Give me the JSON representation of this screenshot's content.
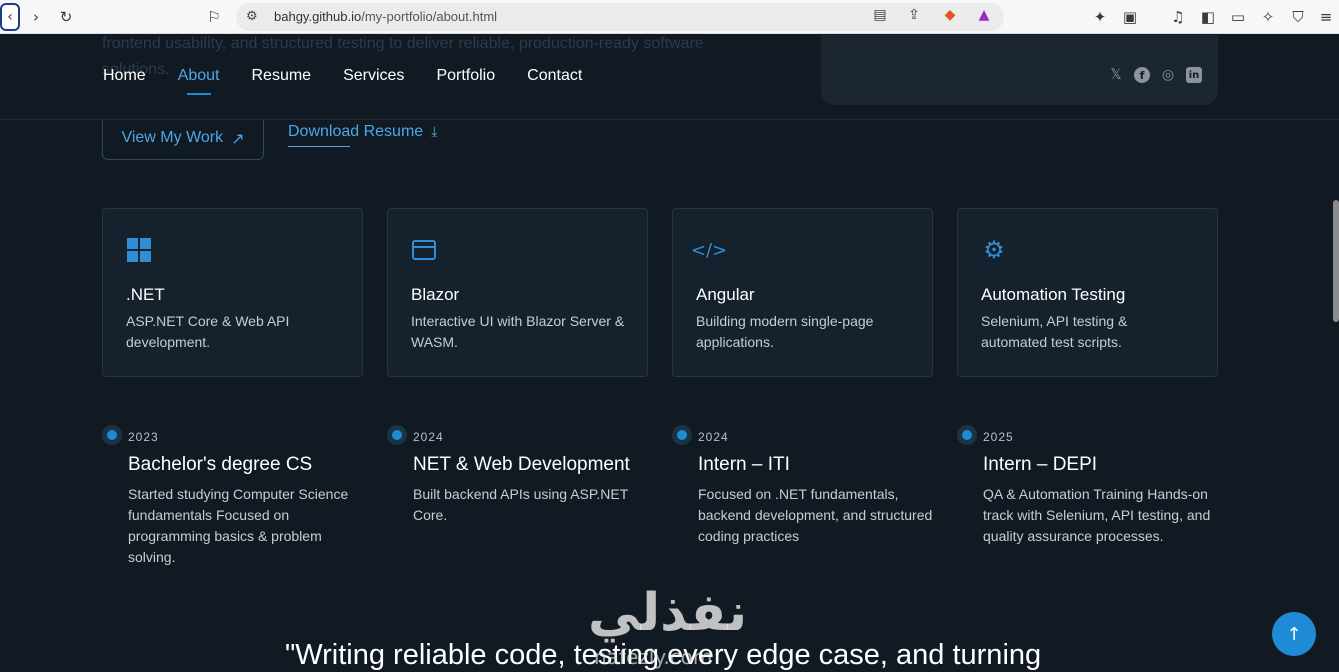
{
  "browser": {
    "url_host": "bahgy.github.io",
    "url_path": "/my-portfolio/about.html"
  },
  "hero": {
    "faded_text": "frontend usability, and structured testing to deliver reliable, production-ready software solutions.",
    "view_work": "View My Work",
    "download_resume": "Download Resume"
  },
  "nav": {
    "items": [
      {
        "label": "Home"
      },
      {
        "label": "About"
      },
      {
        "label": "Resume"
      },
      {
        "label": "Services"
      },
      {
        "label": "Portfolio"
      },
      {
        "label": "Contact"
      }
    ],
    "active": "About"
  },
  "social": [
    "x-icon",
    "facebook-icon",
    "instagram-icon",
    "linkedin-icon"
  ],
  "skills": [
    {
      "icon": "windows-icon",
      "title": ".NET",
      "desc": "ASP.NET Core & Web API development."
    },
    {
      "icon": "browser-window-icon",
      "title": "Blazor",
      "desc": "Interactive UI with Blazor Server & WASM."
    },
    {
      "icon": "code-icon",
      "title": "Angular",
      "desc": "Building modern single-page applications."
    },
    {
      "icon": "gear-icon",
      "title": "Automation Testing",
      "desc": "Selenium, API testing & automated test scripts."
    }
  ],
  "timeline": [
    {
      "year": "2023",
      "title": "Bachelor's degree CS",
      "desc": "Started studying Computer Science fundamentals Focused on programming basics & problem solving."
    },
    {
      "year": "2024",
      "title": "NET & Web Development",
      "desc": "Built backend APIs using ASP.NET Core."
    },
    {
      "year": "2024",
      "title": "Intern – ITI",
      "desc": "Focused on .NET fundamentals, backend development, and structured coding practices"
    },
    {
      "year": "2025",
      "title": "Intern – DEPI",
      "desc": "QA & Automation Training Hands-on track with Selenium, API testing, and quality assurance processes."
    }
  ],
  "quote": "\"Writing reliable code, testing every edge case, and turning",
  "watermark": {
    "arabic": "نفذلي",
    "latin": "nafezly.com"
  },
  "colors": {
    "accent": "#1f8ad6",
    "background": "#111a23",
    "card": "#15212c"
  }
}
